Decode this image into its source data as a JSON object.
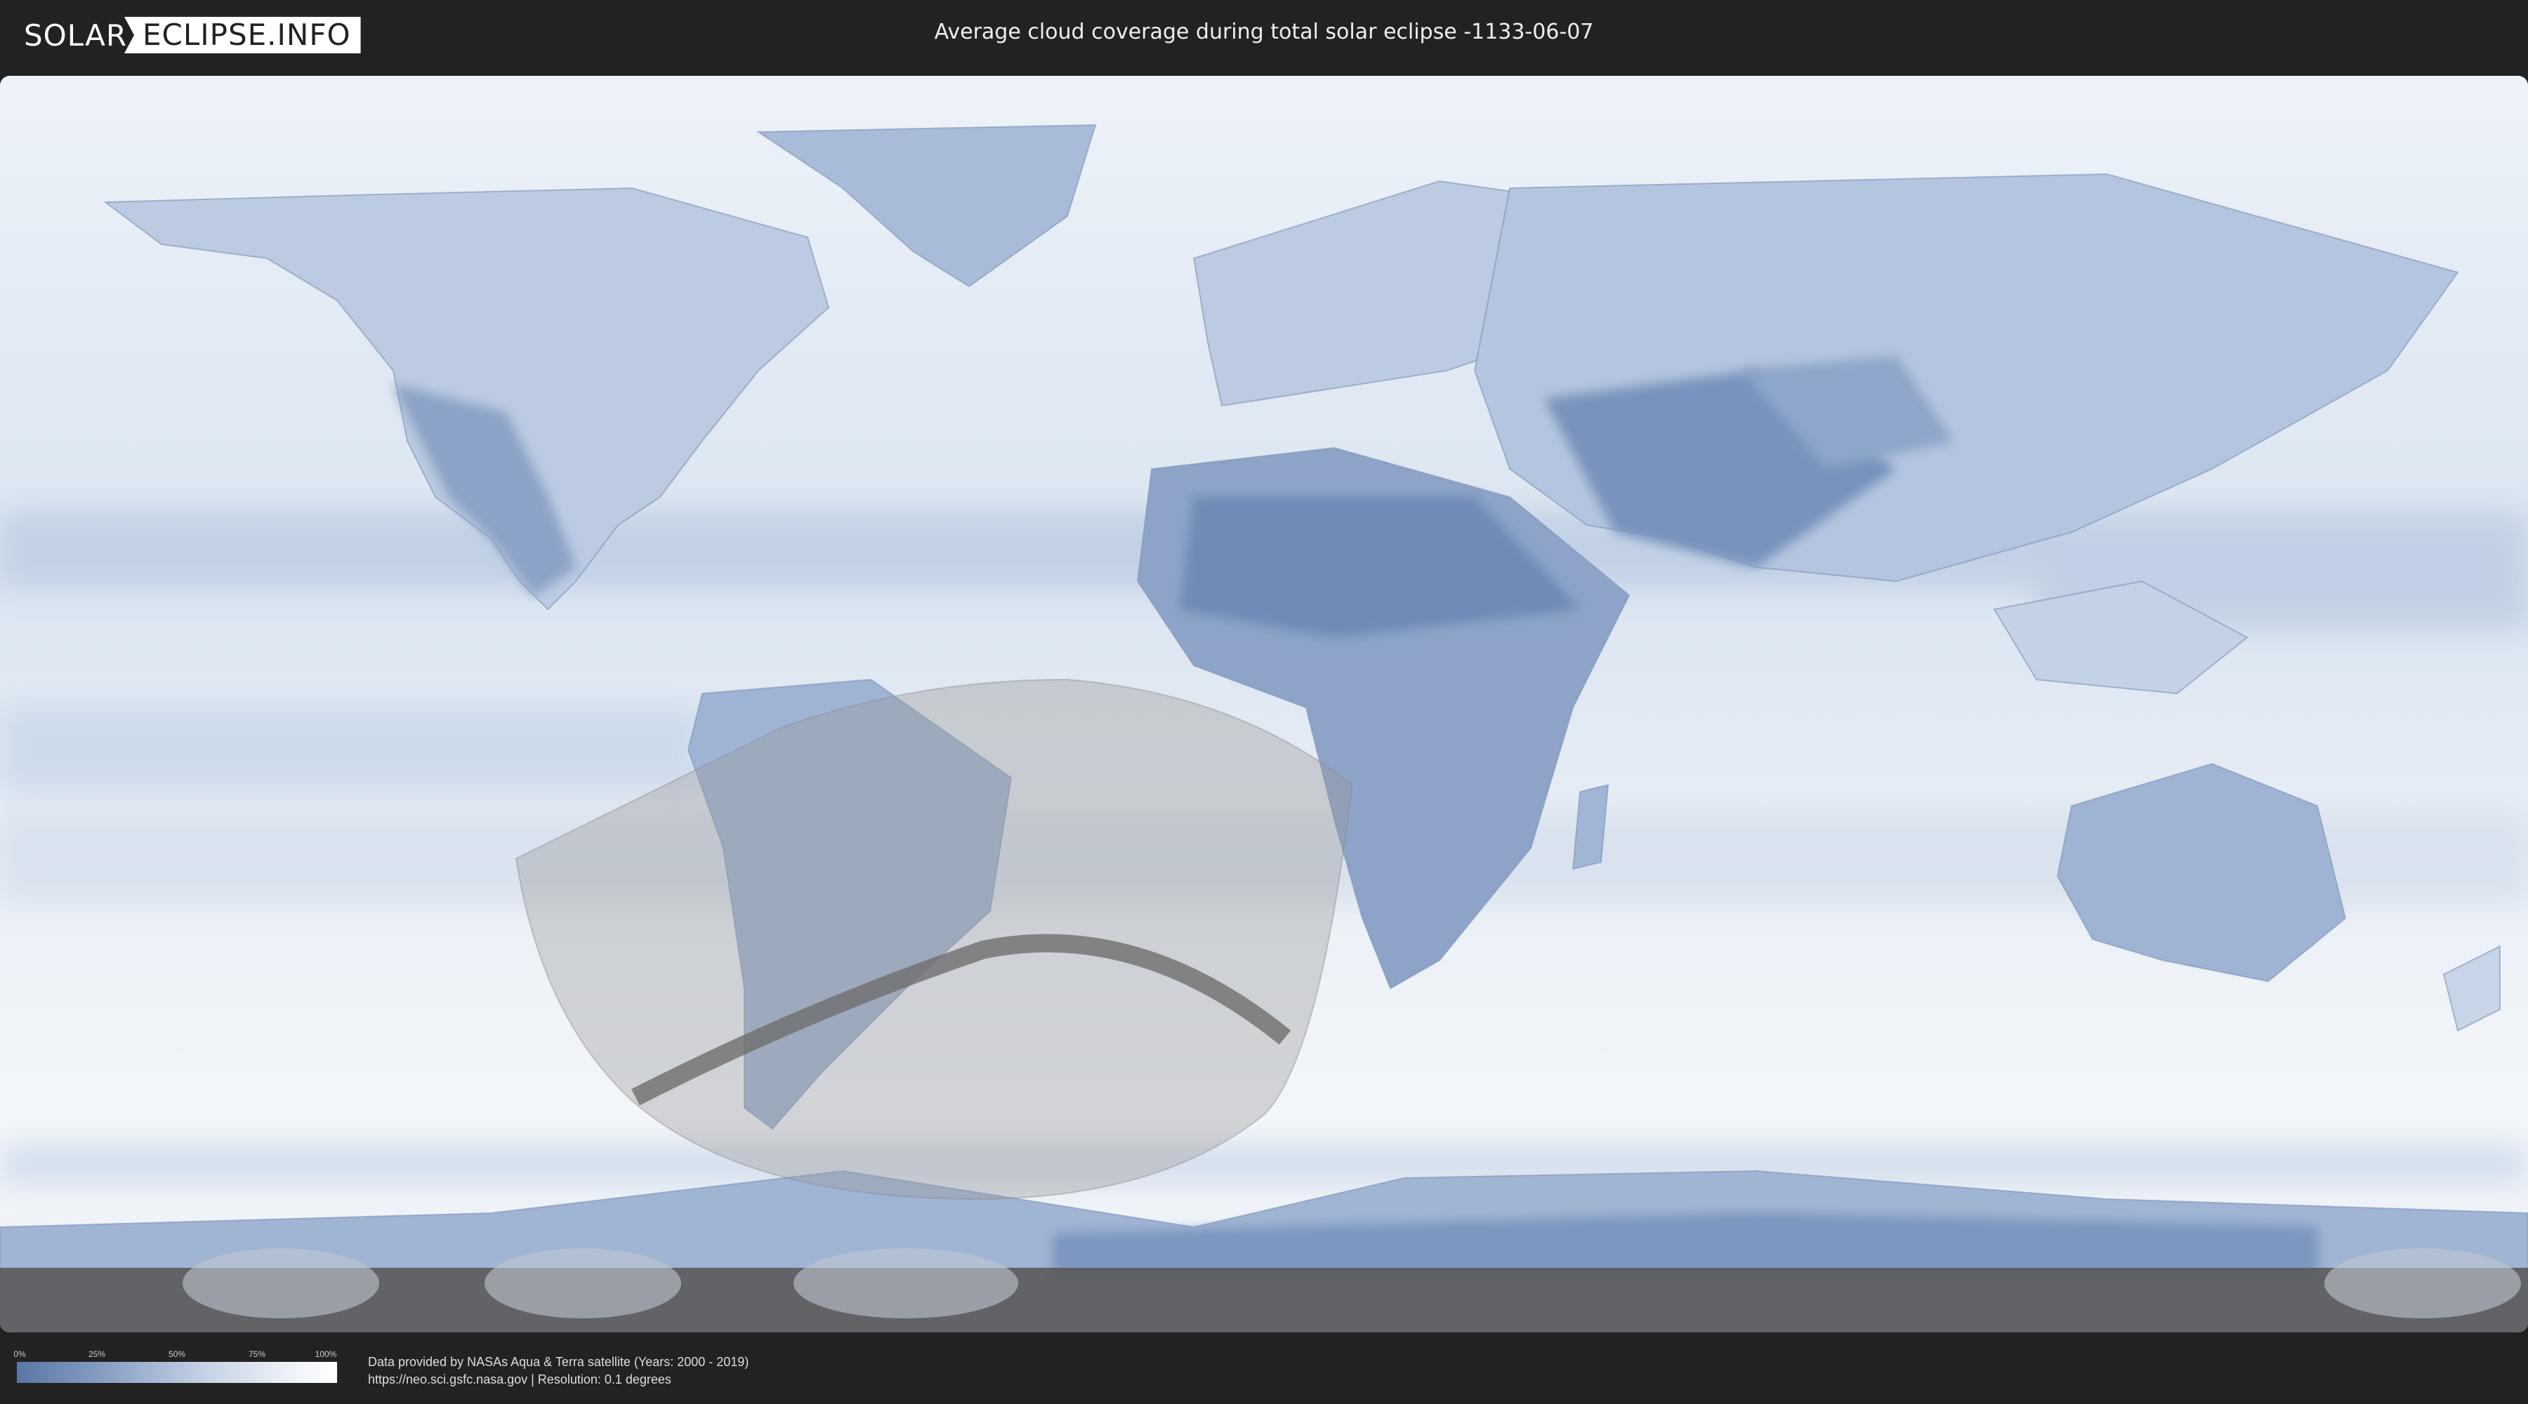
{
  "header": {
    "logo_left": "SOLAR",
    "logo_right": "ECLIPSE.INFO",
    "title": "Average cloud coverage during total solar eclipse -1133-06-07"
  },
  "legend": {
    "ticks": [
      "0%",
      "25%",
      "50%",
      "75%",
      "100%"
    ],
    "color_low": "#5a76a6",
    "color_high": "#ffffff"
  },
  "credits": {
    "line1": "Data provided by NASAs Aqua & Terra satellite (Years: 2000 - 2019)",
    "line2": "https://neo.sci.gsfc.nasa.gov | Resolution: 0.1 degrees"
  },
  "colors": {
    "background": "#222222",
    "ocean_clear": "#e8eef6",
    "land_dark": "#6a86b4",
    "eclipse_shade": "#9a9a9a",
    "totality_path": "#6e6e6e"
  }
}
